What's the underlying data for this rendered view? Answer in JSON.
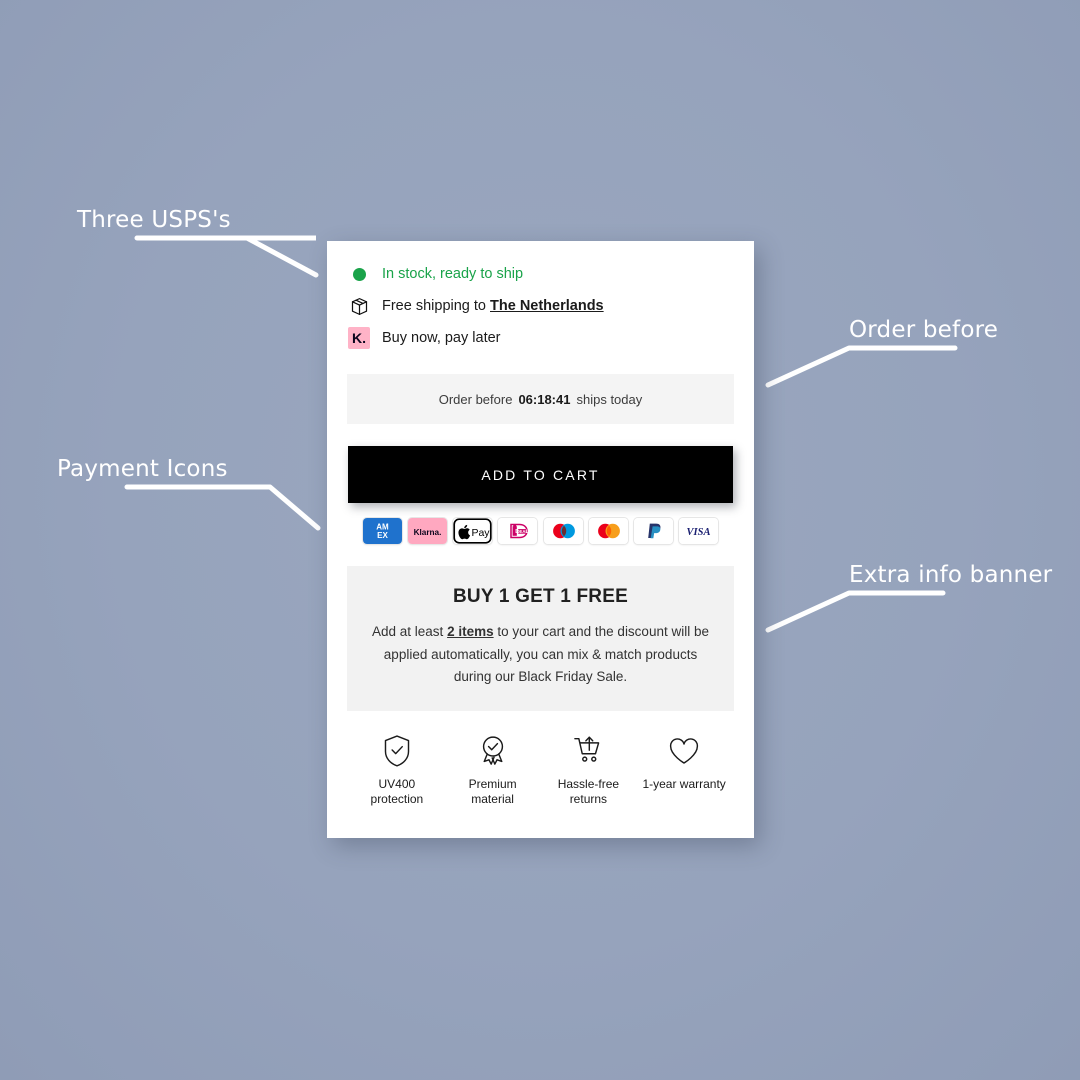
{
  "annotations": [
    {
      "name": "three-usps",
      "label": "Three USPS's"
    },
    {
      "name": "payment-icons",
      "label": "Payment Icons"
    },
    {
      "name": "order-before",
      "label": "Order before"
    },
    {
      "name": "extra-info-banner",
      "label": "Extra info banner"
    }
  ],
  "card": {
    "usps": [
      {
        "icon": "green-dot-icon",
        "text_prefix": "In stock, ready to ship",
        "text_bold": "",
        "text_suffix": ""
      },
      {
        "icon": "package-box-icon",
        "text_prefix": "Free shipping to ",
        "text_bold": "The Netherlands",
        "text_suffix": ""
      },
      {
        "icon": "klarna-icon",
        "text_prefix": "Buy now, pay later",
        "text_bold": "",
        "text_suffix": ""
      }
    ],
    "usp_texts": {
      "in_stock": "In stock, ready to ship",
      "free_shipping_prefix": "Free shipping to ",
      "free_shipping_country": "The Netherlands",
      "buy_now_pay_later": "Buy now, pay later",
      "klarna_mark": "K."
    },
    "order_bar": {
      "prefix": "Order before",
      "time": "06:18:41",
      "suffix": "ships today"
    },
    "add_to_cart_label": "ADD TO CART",
    "payment_methods": [
      {
        "name": "amex",
        "label": "AMEX"
      },
      {
        "name": "klarna",
        "label": "Klarna."
      },
      {
        "name": "apple-pay",
        "label": "Pay"
      },
      {
        "name": "ideal",
        "label": "iDEAL"
      },
      {
        "name": "maestro",
        "label": "Maestro"
      },
      {
        "name": "mastercard",
        "label": "Mastercard"
      },
      {
        "name": "paypal",
        "label": "PayPal"
      },
      {
        "name": "visa",
        "label": "VISA"
      }
    ],
    "promo": {
      "title": "BUY 1 GET 1 FREE",
      "body_prefix": "Add at least ",
      "body_bold": "2 items",
      "body_suffix": " to your cart and the discount will be applied automatically, you can mix & match products during our Black Friday Sale."
    },
    "trust_badges": [
      {
        "icon": "shield-check-icon",
        "line1": "UV400",
        "line2": "protection"
      },
      {
        "icon": "award-check-icon",
        "line1": "Premium",
        "line2": "material"
      },
      {
        "icon": "cart-return-icon",
        "line1": "Hassle-free",
        "line2": "returns"
      },
      {
        "icon": "heart-icon",
        "line1": "1-year warranty",
        "line2": ""
      }
    ]
  },
  "colors": {
    "background": "#96a3bc",
    "in_stock_green": "#1aa34a",
    "klarna_pink": "#ffb3c7",
    "button_black": "#000000",
    "banner_grey": "#f2f2f2",
    "annotation_white": "#ffffff"
  }
}
